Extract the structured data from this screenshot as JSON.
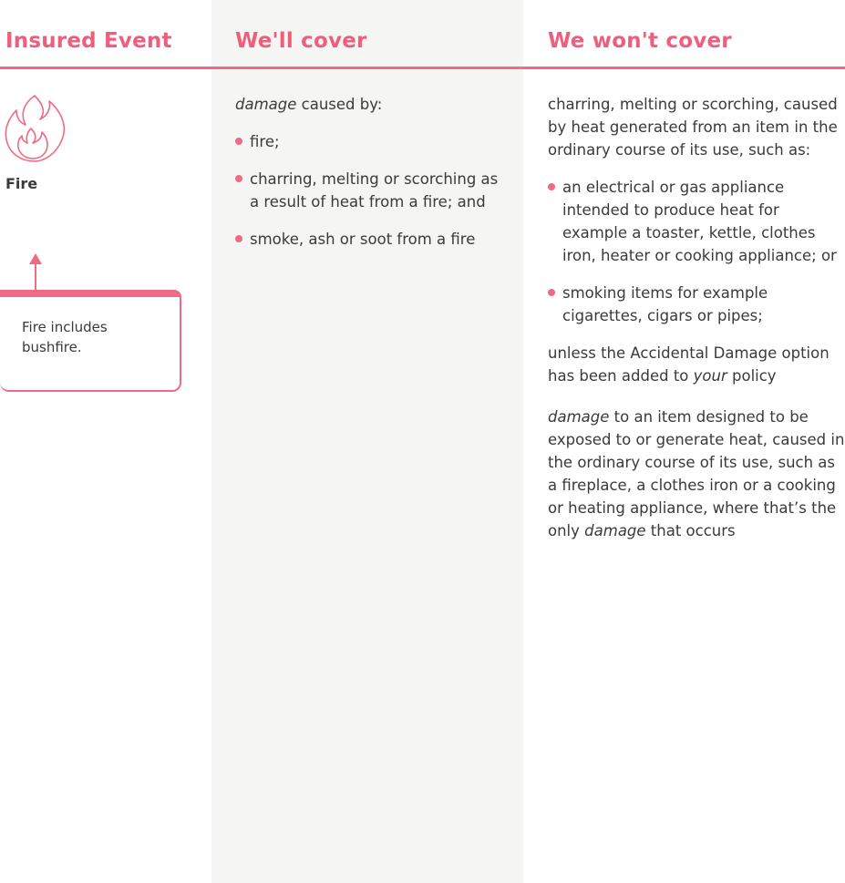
{
  "headers": {
    "insured_event": "Insured Event",
    "we_cover": "We'll cover",
    "we_wont_cover": "We won't cover"
  },
  "event": {
    "icon": "fire-icon",
    "title": "Fire",
    "note": "Fire includes bushfire."
  },
  "cover": {
    "intro_italic": "damage",
    "intro_rest": " caused by:",
    "items": [
      "fire;",
      "charring, melting or scorching as a result of heat from a fire; and",
      "smoke, ash or soot from a fire"
    ]
  },
  "not_cover": {
    "intro": "charring, melting or scorching, caused by heat generated from an item in the ordinary course of its use, such as:",
    "items": [
      "an electrical or gas appliance intended to produce heat for example a toaster, kettle, clothes iron, heater or cooking appliance; or",
      "smoking items for example cigarettes, cigars or pipes;"
    ],
    "unless_pre": "unless the Accidental Damage option has been added to ",
    "unless_italic": "your",
    "unless_post": " policy",
    "para2_italic_a": "damage",
    "para2_mid": " to an item designed to be exposed to or generate heat, caused in the ordinary course of its use, such as a fireplace, a clothes iron or a cooking or heating appliance, where that’s the only ",
    "para2_italic_b": "damage",
    "para2_end": " that occurs"
  },
  "colors": {
    "accent": "#ef6a85",
    "shaded_column": "#f5f5f4",
    "text": "#3a3a3a"
  }
}
